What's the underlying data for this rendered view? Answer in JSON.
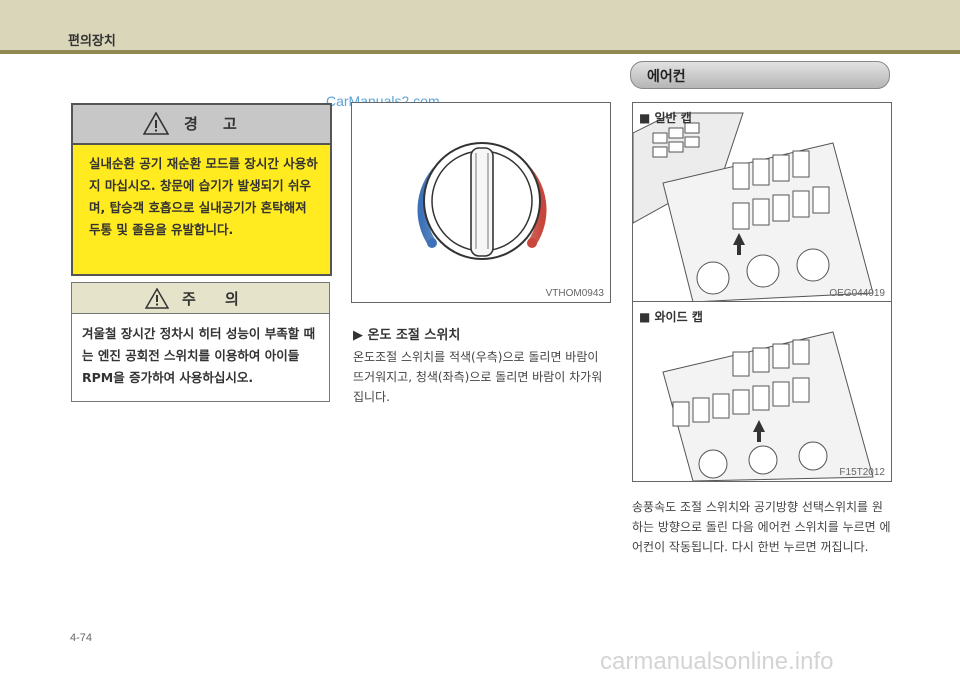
{
  "header": {
    "section_title": "편의장치"
  },
  "watermark_top": "CarManuals2.com",
  "warning": {
    "title": "경  고",
    "body": "실내순환 공기 재순환 모드를 장시간 사용하지 마십시오. 창문에 습기가 발생되기 쉬우며, 탑승객 호흡으로 실내공기가 혼탁해져 두통 및 졸음을 유발합니다."
  },
  "caution": {
    "title": "주  의",
    "body": "겨울철 장시간 정차시 히터 성능이 부족할 때는 엔진 공회전 스위치를 이용하여 아이들 RPM을 증가하여 사용하십시오."
  },
  "figure1": {
    "code": "VTHOM0943"
  },
  "temp_section": {
    "subhead": "▶ 온도 조절 스위치",
    "body": "온도조절 스위치를 적색(우측)으로 돌리면 바람이 뜨거워지고, 청색(좌측)으로 돌리면 바람이 차가워 집니다."
  },
  "aircon_header": "에어컨",
  "figure2": {
    "label": "■ 일반 캡",
    "code": "OEG044019"
  },
  "figure3": {
    "label": "■ 와이드 캡",
    "code": "F15T2012"
  },
  "aircon_body": "송풍속도 조절 스위치와 공기방향 선택스위치를 원하는 방향으로 돌린 다음 에어컨 스위치를 누르면 에어컨이 작동됩니다. 다시 한번 누르면 꺼집니다.",
  "page_number": "4-74",
  "footer": "carmanualsonline.info",
  "colors": {
    "warning_bg": "#ffeb1f",
    "topbar": "#d9d6ba",
    "stripe": "#8e8a52",
    "red": "#c8463a",
    "blue": "#3d72b8"
  }
}
